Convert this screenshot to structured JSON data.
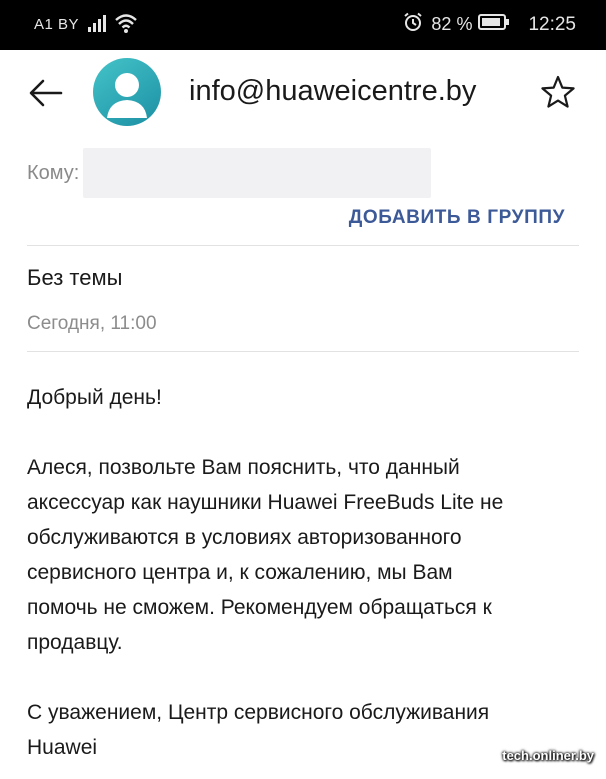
{
  "status_bar": {
    "carrier": "A1 BY",
    "battery_percent": "82 %",
    "time": "12:25"
  },
  "header": {
    "sender": "info@huaweicentre.by"
  },
  "recipient": {
    "label": "Кому:",
    "value": ""
  },
  "actions": {
    "add_group": "ДОБАВИТЬ В ГРУППУ"
  },
  "email": {
    "subject": "Без темы",
    "date": "Сегодня, 11:00",
    "greeting": "Добрый день!",
    "body_lines": [
      "Алеся, позвольте Вам пояснить, что данный",
      "аксессуар как наушники Huawei FreeBuds Lite не",
      "обслуживаются в условиях авторизованного",
      "сервисного центра и, к сожалению, мы Вам",
      "помочь не сможем. Рекомендуем обращаться к",
      "продавцу."
    ],
    "signature_lines": [
      "С уважением, Центр сервисного обслуживания",
      "Huawei"
    ]
  },
  "watermark": "tech.onliner.by",
  "colors": {
    "status_bg": "#000000",
    "accent": "#3d5a98",
    "avatar": "#2aaab5"
  },
  "icons": [
    "signal-icon",
    "wifi-icon",
    "alarm-icon",
    "battery-icon",
    "back-arrow-icon",
    "avatar-person-icon",
    "star-icon"
  ]
}
